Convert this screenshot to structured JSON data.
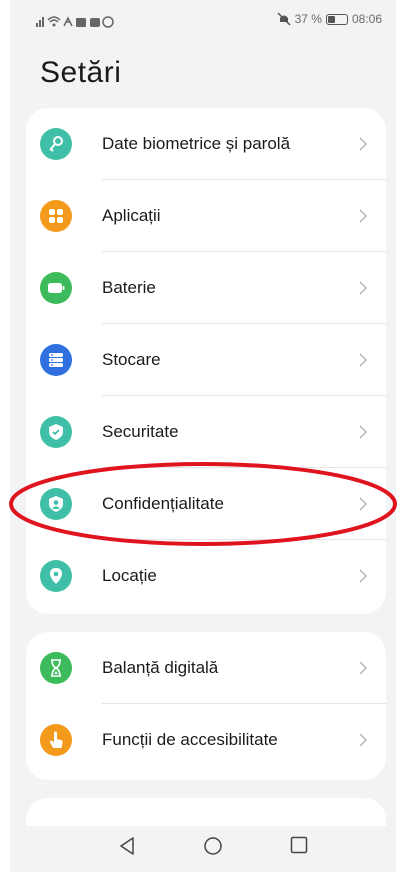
{
  "status_bar": {
    "battery_percent": "37 %",
    "time": "08:06",
    "battery_level": 0.37
  },
  "header": {
    "title": "Setări"
  },
  "groups": [
    {
      "items": [
        {
          "label": "Date biometrice și parolă",
          "icon": "key-icon",
          "color": "#3fbfa8"
        },
        {
          "label": "Aplicații",
          "icon": "apps-grid-icon",
          "color": "#f39a1d"
        },
        {
          "label": "Baterie",
          "icon": "battery-icon",
          "color": "#3dbb5c"
        },
        {
          "label": "Stocare",
          "icon": "storage-icon",
          "color": "#2f6fe0"
        },
        {
          "label": "Securitate",
          "icon": "shield-icon",
          "color": "#3fbfa8"
        },
        {
          "label": "Confidențialitate",
          "icon": "privacy-icon",
          "color": "#3fbfa8"
        },
        {
          "label": "Locație",
          "icon": "location-pin-icon",
          "color": "#3fbfa8"
        }
      ]
    },
    {
      "items": [
        {
          "label": "Balanță digitală",
          "icon": "hourglass-icon",
          "color": "#3dbb5c"
        },
        {
          "label": "Funcții de accesibilitate",
          "icon": "hand-icon",
          "color": "#f39a1d"
        }
      ]
    }
  ],
  "annotation": {
    "color": "#e0141e"
  },
  "nav": {
    "back": "back-icon",
    "home": "home-icon",
    "recents": "recents-icon"
  }
}
